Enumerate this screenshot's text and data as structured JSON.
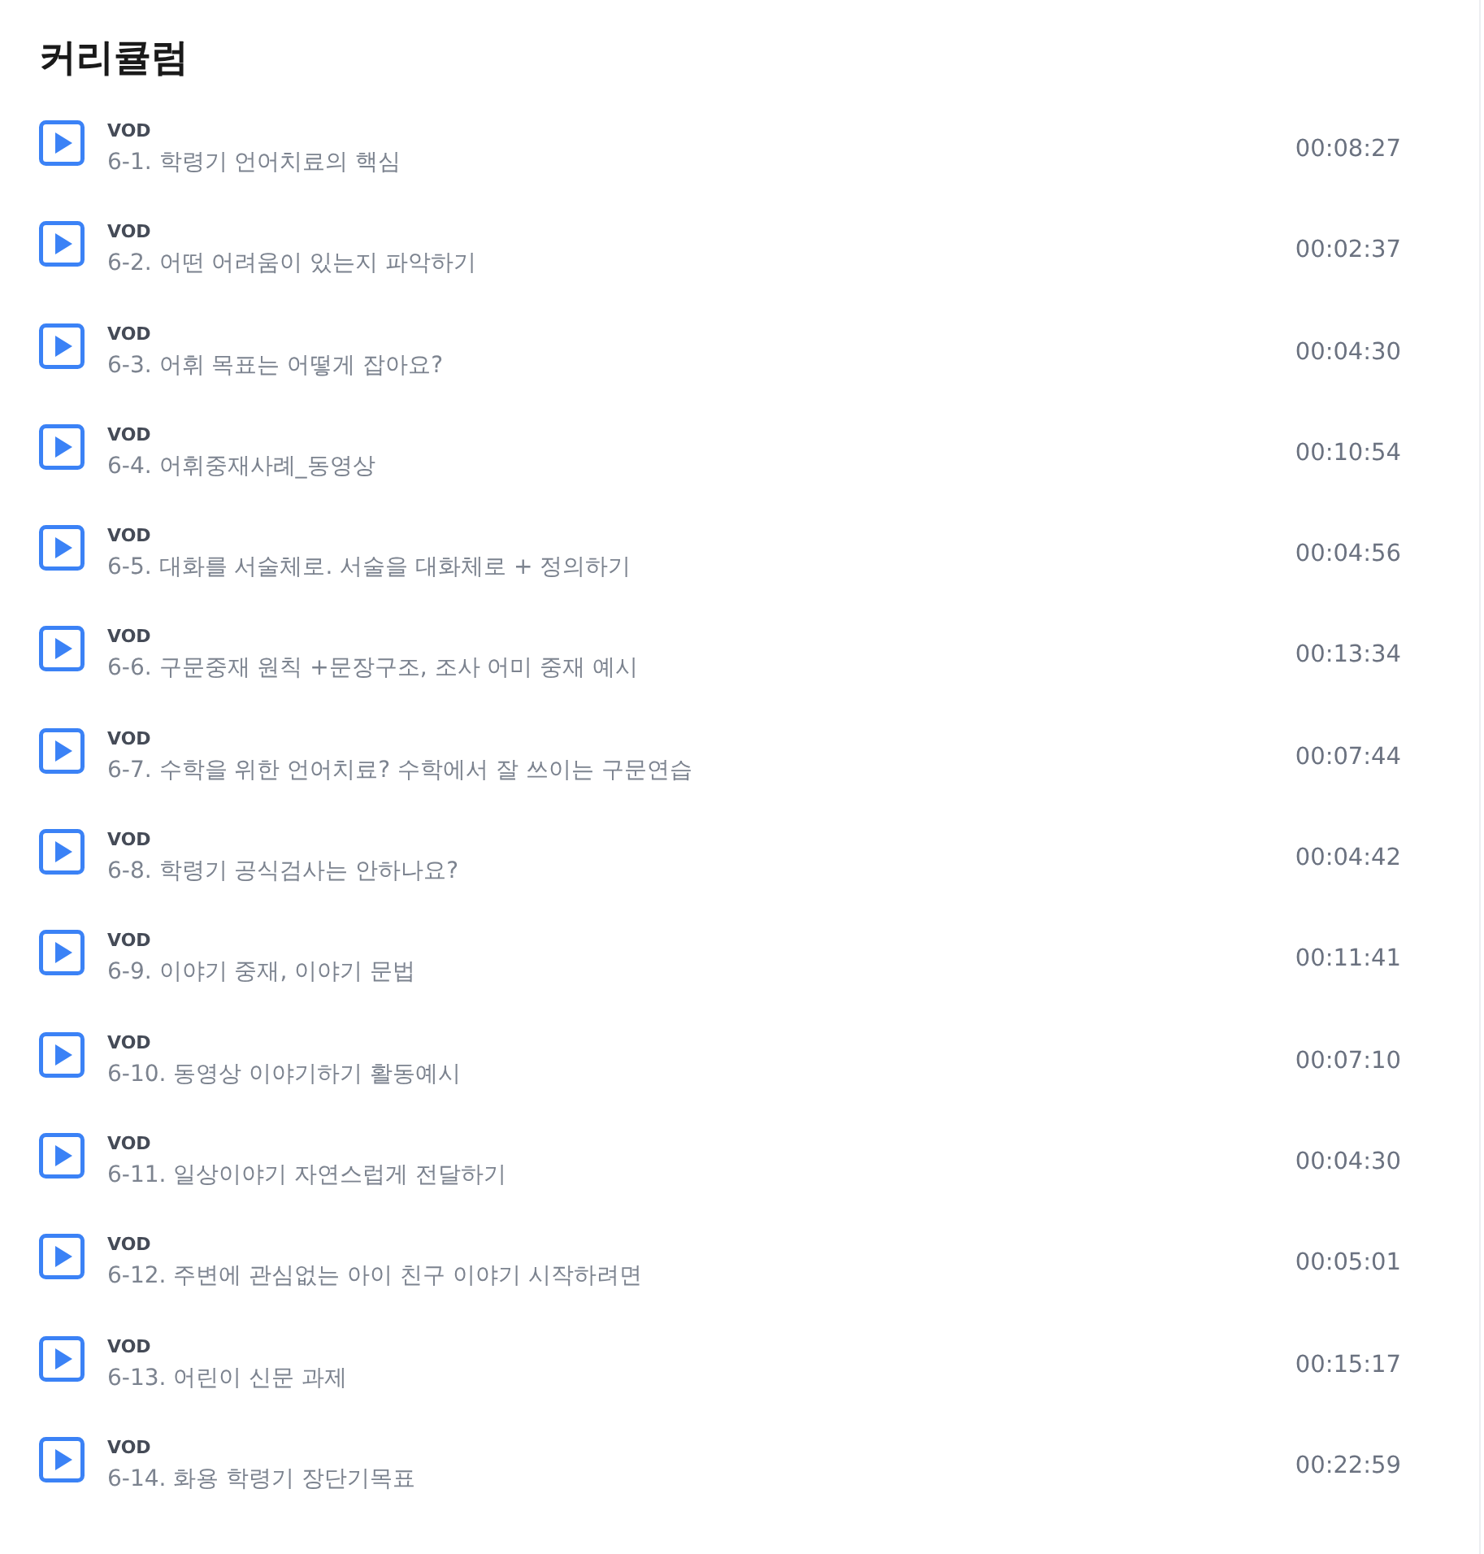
{
  "title": "커리큘럼",
  "lessons": [
    {
      "type": "VOD",
      "title": "6-1. 학령기 언어치료의 핵심",
      "duration": "00:08:27"
    },
    {
      "type": "VOD",
      "title": "6-2. 어떤 어려움이 있는지 파악하기",
      "duration": "00:02:37"
    },
    {
      "type": "VOD",
      "title": "6-3. 어휘 목표는 어떻게 잡아요?",
      "duration": "00:04:30"
    },
    {
      "type": "VOD",
      "title": "6-4. 어휘중재사례_동영상",
      "duration": "00:10:54"
    },
    {
      "type": "VOD",
      "title": "6-5. 대화를 서술체로. 서술을 대화체로 + 정의하기",
      "duration": "00:04:56"
    },
    {
      "type": "VOD",
      "title": "6-6. 구문중재 원칙 +문장구조, 조사 어미 중재 예시",
      "duration": "00:13:34"
    },
    {
      "type": "VOD",
      "title": "6-7. 수학을 위한 언어치료? 수학에서 잘 쓰이는 구문연습",
      "duration": "00:07:44"
    },
    {
      "type": "VOD",
      "title": "6-8. 학령기 공식검사는 안하나요?",
      "duration": "00:04:42"
    },
    {
      "type": "VOD",
      "title": "6-9. 이야기 중재, 이야기 문법",
      "duration": "00:11:41"
    },
    {
      "type": "VOD",
      "title": "6-10. 동영상 이야기하기 활동예시",
      "duration": "00:07:10"
    },
    {
      "type": "VOD",
      "title": "6-11. 일상이야기 자연스럽게 전달하기",
      "duration": "00:04:30"
    },
    {
      "type": "VOD",
      "title": "6-12. 주변에 관심없는 아이 친구 이야기 시작하려면",
      "duration": "00:05:01"
    },
    {
      "type": "VOD",
      "title": "6-13. 어린이 신문 과제",
      "duration": "00:15:17"
    },
    {
      "type": "VOD",
      "title": "6-14. 화용 학령기 장단기목표",
      "duration": "00:22:59"
    }
  ]
}
